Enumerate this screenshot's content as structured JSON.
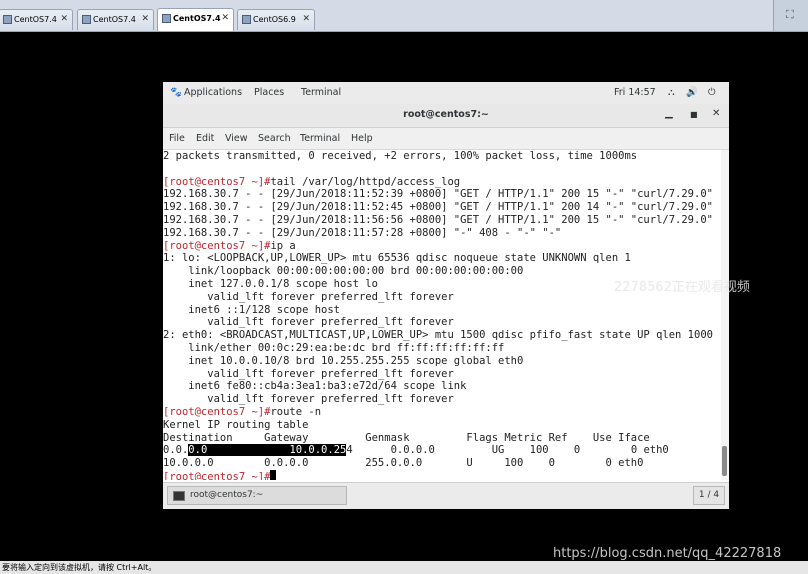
{
  "vm_tabs": [
    {
      "label": "CentOS7.4",
      "active": false
    },
    {
      "label": "CentOS7.4",
      "active": false
    },
    {
      "label": "CentOS7.4",
      "active": true
    },
    {
      "label": "CentOS6.9",
      "active": false
    }
  ],
  "gnome_bar": {
    "applications": "Applications",
    "places": "Places",
    "terminal": "Terminal",
    "clock": "Fri 14:57"
  },
  "window": {
    "title": "root@centos7:~",
    "menu": [
      "File",
      "Edit",
      "View",
      "Search",
      "Terminal",
      "Help"
    ]
  },
  "terminal": {
    "prompt": "[root@centos7 ~]#",
    "line_ping": "2 packets transmitted, 0 received, +2 errors, 100% packet loss, time 1000ms",
    "cmd_tail": "tail /var/log/httpd/access_log",
    "log": [
      "192.168.30.7 - - [29/Jun/2018:11:52:39 +0800] \"GET / HTTP/1.1\" 200 15 \"-\" \"curl/7.29.0\"",
      "192.168.30.7 - - [29/Jun/2018:11:52:45 +0800] \"GET / HTTP/1.1\" 200 14 \"-\" \"curl/7.29.0\"",
      "192.168.30.7 - - [29/Jun/2018:11:56:56 +0800] \"GET / HTTP/1.1\" 200 15 \"-\" \"curl/7.29.0\"",
      "192.168.30.7 - - [29/Jun/2018:11:57:28 +0800] \"-\" 408 - \"-\" \"-\""
    ],
    "cmd_ipa": "ip a",
    "ipa": [
      "1: lo: <LOOPBACK,UP,LOWER_UP> mtu 65536 qdisc noqueue state UNKNOWN qlen 1",
      "    link/loopback 00:00:00:00:00:00 brd 00:00:00:00:00:00",
      "    inet 127.0.0.1/8 scope host lo",
      "       valid_lft forever preferred_lft forever",
      "    inet6 ::1/128 scope host",
      "       valid_lft forever preferred_lft forever",
      "2: eth0: <BROADCAST,MULTICAST,UP,LOWER_UP> mtu 1500 qdisc pfifo_fast state UP qlen 1000",
      "    link/ether 00:0c:29:ea:be:dc brd ff:ff:ff:ff:ff:ff",
      "    inet 10.0.0.10/8 brd 10.255.255.255 scope global eth0",
      "       valid_lft forever preferred_lft forever",
      "    inet6 fe80::cb4a:3ea1:ba3:e72d/64 scope link",
      "       valid_lft forever preferred_lft forever"
    ],
    "cmd_route": "route -n",
    "route_title": "Kernel IP routing table",
    "route_header": "Destination     Gateway         Genmask         Flags Metric Ref    Use Iface",
    "route_r1_pre": "0.0.",
    "route_r1_hl": "0.0             10.0.0.25",
    "route_r1_post": "4      0.0.0.0         UG    100    0        0 eth0",
    "route_r2": "10.0.0.0        0.0.0.0         255.0.0.0       U     100    0        0 eth0"
  },
  "taskbar": {
    "item": "root@centos7:~",
    "pager": "1 / 4"
  },
  "host_status": "要将输入定向到该虚拟机，请按 Ctrl+Alt。",
  "watermarks": {
    "overlay": "2278562正在观看视频",
    "blog": "https://blog.csdn.net/qq_42227818"
  }
}
